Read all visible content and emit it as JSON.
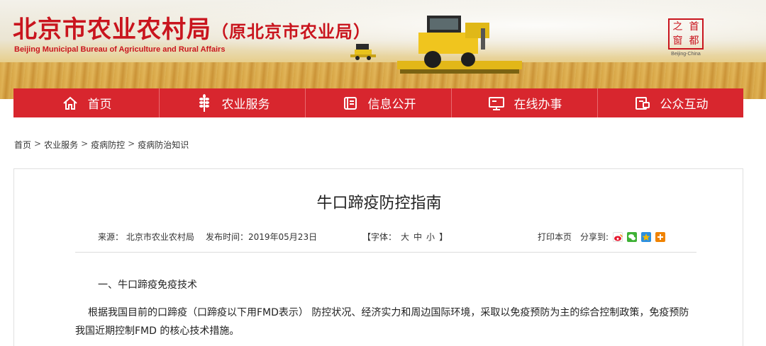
{
  "header": {
    "title_main": "北京市农业农村局",
    "title_sub": "（原北京市农业局）",
    "title_en": "Beijing Municipal Bureau of Agriculture and Rural Affairs",
    "logo_chars": [
      "首",
      "之",
      "都",
      "窗"
    ],
    "logo_caption": "Beijing-China"
  },
  "nav": [
    {
      "label": "首页",
      "icon": "home-icon"
    },
    {
      "label": "农业服务",
      "icon": "wheat-icon"
    },
    {
      "label": "信息公开",
      "icon": "document-icon"
    },
    {
      "label": "在线办事",
      "icon": "monitor-icon"
    },
    {
      "label": "公众互动",
      "icon": "chat-icon"
    }
  ],
  "breadcrumb": [
    "首页",
    "农业服务",
    "疫病防控",
    "疫病防治知识"
  ],
  "breadcrumb_separator": ">",
  "article": {
    "title": "牛口蹄疫防控指南",
    "source": "来源：  北京市农业农村局",
    "publish_time": "发布时间：2019年05月23日",
    "font_size_label_open": "【字体：",
    "font_large": "大",
    "font_medium": "中",
    "font_small": "小",
    "font_size_label_close": "】",
    "print": "打印本页",
    "share_label": "分享到:",
    "share_icons": [
      {
        "name": "weibo-share-icon",
        "color": "#e6162d"
      },
      {
        "name": "wechat-share-icon",
        "color": "#3eb135"
      },
      {
        "name": "qzone-share-icon",
        "color": "#f5b800"
      },
      {
        "name": "more-share-icon",
        "color": "#f08300"
      }
    ],
    "section_heading": "一、牛口蹄疫免疫技术",
    "paragraph": "根据我国目前的口蹄疫（口蹄疫以下用FMD表示） 防控状况、经济实力和周边国际环境，采取以免疫预防为主的综合控制政策，免疫预防我国近期控制FMD 的核心技术措施。"
  },
  "colors": {
    "brand_red": "#c9151e",
    "nav_red": "#d8262e"
  }
}
